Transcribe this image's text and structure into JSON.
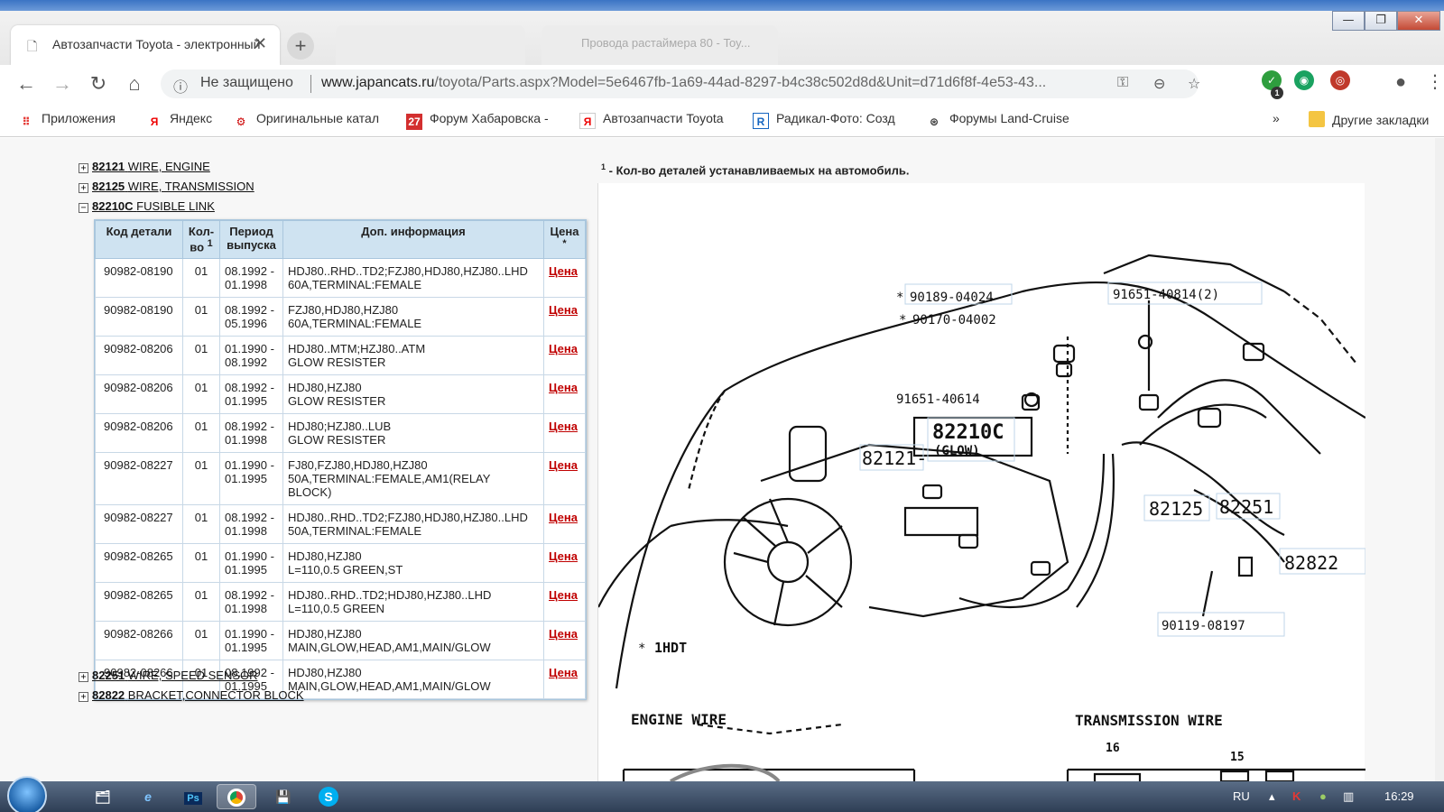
{
  "browser": {
    "active_tab_title": "Автозапчасти Toyota - электронный каталог",
    "ghost_tab_1": "",
    "ghost_tab_2": "Провода растаймера 80 - Toy...",
    "new_tab_symbol": "+",
    "close_symbol": "✕",
    "not_secure_label": "Не защищено",
    "url_host": "www.japancats.ru",
    "url_path": "/toyota/Parts.aspx?Model=5e6467fb-1a69-44ad-8297-b4c38c502d8d&Unit=d71d6f8f-4e53-43...",
    "window_controls": {
      "minimize": "—",
      "maximize": "❐",
      "close": "✕"
    },
    "extension_badge": "1"
  },
  "bookmarks": [
    {
      "label": "Приложения",
      "icon": "apps-grid-icon"
    },
    {
      "label": "Яндекс",
      "icon": "yandex-icon"
    },
    {
      "label": "Оригинальные катал",
      "icon": "catalog-icon"
    },
    {
      "label": "Форум Хабаровска -",
      "icon": "forum-27-icon",
      "icon_text": "27"
    },
    {
      "label": "Автозапчасти Toyota",
      "icon": "yandex-page-icon"
    },
    {
      "label": "Радикал-Фото: Созд",
      "icon": "radikal-icon"
    },
    {
      "label": "Форумы Land-Cruise",
      "icon": "toyota-icon"
    }
  ],
  "bookmarks_more": "»",
  "bookmarks_other": "Другие закладки",
  "tree": {
    "items_top": [
      {
        "code": "82121",
        "name": "WIRE, ENGINE",
        "toggle": "+"
      },
      {
        "code": "82125",
        "name": "WIRE, TRANSMISSION",
        "toggle": "+"
      },
      {
        "code": "82210C",
        "name": "FUSIBLE LINK",
        "toggle": "−"
      }
    ],
    "items_bottom": [
      {
        "code": "82251",
        "name": "WIRE, SPEED SENSOR",
        "toggle": "+"
      },
      {
        "code": "82822",
        "name": "BRACKET,CONNECTOR BLOCK",
        "toggle": "+"
      }
    ]
  },
  "table": {
    "headers": {
      "code": "Код детали",
      "qty_line1": "Кол-",
      "qty_line2": "во",
      "qty_sup": "1",
      "period_line1": "Период",
      "period_line2": "выпуска",
      "info": "Доп. информация",
      "price": "Цена",
      "price_sup": "*"
    },
    "rows": [
      {
        "code": "90982-08190",
        "qty": "01",
        "period1": "08.1992 -",
        "period2": "01.1998",
        "info1": "HDJ80..RHD..TD2;FZJ80,HDJ80,HZJ80..LHD",
        "info2": "60A,TERMINAL:FEMALE",
        "info3": "",
        "price": "Цена"
      },
      {
        "code": "90982-08190",
        "qty": "01",
        "period1": "08.1992 -",
        "period2": "05.1996",
        "info1": "FZJ80,HDJ80,HZJ80",
        "info2": "60A,TERMINAL:FEMALE",
        "info3": "",
        "price": "Цена"
      },
      {
        "code": "90982-08206",
        "qty": "01",
        "period1": "01.1990 -",
        "period2": "08.1992",
        "info1": "HDJ80..MTM;HZJ80..ATM",
        "info2": "GLOW RESISTER",
        "info3": "",
        "price": "Цена"
      },
      {
        "code": "90982-08206",
        "qty": "01",
        "period1": "08.1992 -",
        "period2": "01.1995",
        "info1": "HDJ80,HZJ80",
        "info2": "GLOW RESISTER",
        "info3": "",
        "price": "Цена"
      },
      {
        "code": "90982-08206",
        "qty": "01",
        "period1": "08.1992 -",
        "period2": "01.1998",
        "info1": "HDJ80;HZJ80..LUB",
        "info2": "GLOW RESISTER",
        "info3": "",
        "price": "Цена"
      },
      {
        "code": "90982-08227",
        "qty": "01",
        "period1": "01.1990 -",
        "period2": "01.1995",
        "info1": "FJ80,FZJ80,HDJ80,HZJ80",
        "info2": "50A,TERMINAL:FEMALE,AM1(RELAY",
        "info3": "BLOCK)",
        "price": "Цена"
      },
      {
        "code": "90982-08227",
        "qty": "01",
        "period1": "08.1992 -",
        "period2": "01.1998",
        "info1": "HDJ80..RHD..TD2;FZJ80,HDJ80,HZJ80..LHD",
        "info2": "50A,TERMINAL:FEMALE",
        "info3": "",
        "price": "Цена"
      },
      {
        "code": "90982-08265",
        "qty": "01",
        "period1": "01.1990 -",
        "period2": "01.1995",
        "info1": "HDJ80,HZJ80",
        "info2": "L=110,0.5 GREEN,ST",
        "info3": "",
        "price": "Цена"
      },
      {
        "code": "90982-08265",
        "qty": "01",
        "period1": "08.1992 -",
        "period2": "01.1998",
        "info1": "HDJ80..RHD..TD2;HDJ80,HZJ80..LHD",
        "info2": "L=110,0.5 GREEN",
        "info3": "",
        "price": "Цена"
      },
      {
        "code": "90982-08266",
        "qty": "01",
        "period1": "01.1990 -",
        "period2": "01.1995",
        "info1": "HDJ80,HZJ80",
        "info2": "MAIN,GLOW,HEAD,AM1,MAIN/GLOW",
        "info3": "",
        "price": "Цена"
      },
      {
        "code": "90982-08266",
        "qty": "01",
        "period1": "08.1992 -",
        "period2": "01.1995",
        "info1": "HDJ80,HZJ80",
        "info2": "MAIN,GLOW,HEAD,AM1,MAIN/GLOW",
        "info3": "",
        "price": "Цена"
      }
    ]
  },
  "footnote": {
    "sup": "1",
    "text": " - Кол-во деталей устанавливаемых на автомобиль."
  },
  "diagram": {
    "labels": {
      "p1": "90189-04024",
      "p2": "90170-04002",
      "p3": "91651-40814(2)",
      "p4": "91651-40614",
      "p5": "82210C",
      "p5b": "(GLOW)",
      "p6": "82121-",
      "p7": "82125",
      "p8": "82251",
      "p9": "82822",
      "p10": "90119-08197",
      "note": "1HDT",
      "star": "*",
      "engine_wire": "ENGINE WIRE",
      "transmission_wire": "TRANSMISSION WIRE",
      "dim16": "16",
      "dim15": "15"
    }
  },
  "taskbar": {
    "lang": "RU",
    "time": "16:29",
    "apps": [
      {
        "icon": "explorer-icon",
        "text": "🗂"
      },
      {
        "icon": "ie-icon",
        "text": "e"
      },
      {
        "icon": "photoshop-icon",
        "text": "Ps"
      },
      {
        "icon": "chrome-icon",
        "text": ""
      },
      {
        "icon": "save-icon",
        "text": "💾"
      },
      {
        "icon": "skype-icon",
        "text": "S"
      }
    ]
  }
}
